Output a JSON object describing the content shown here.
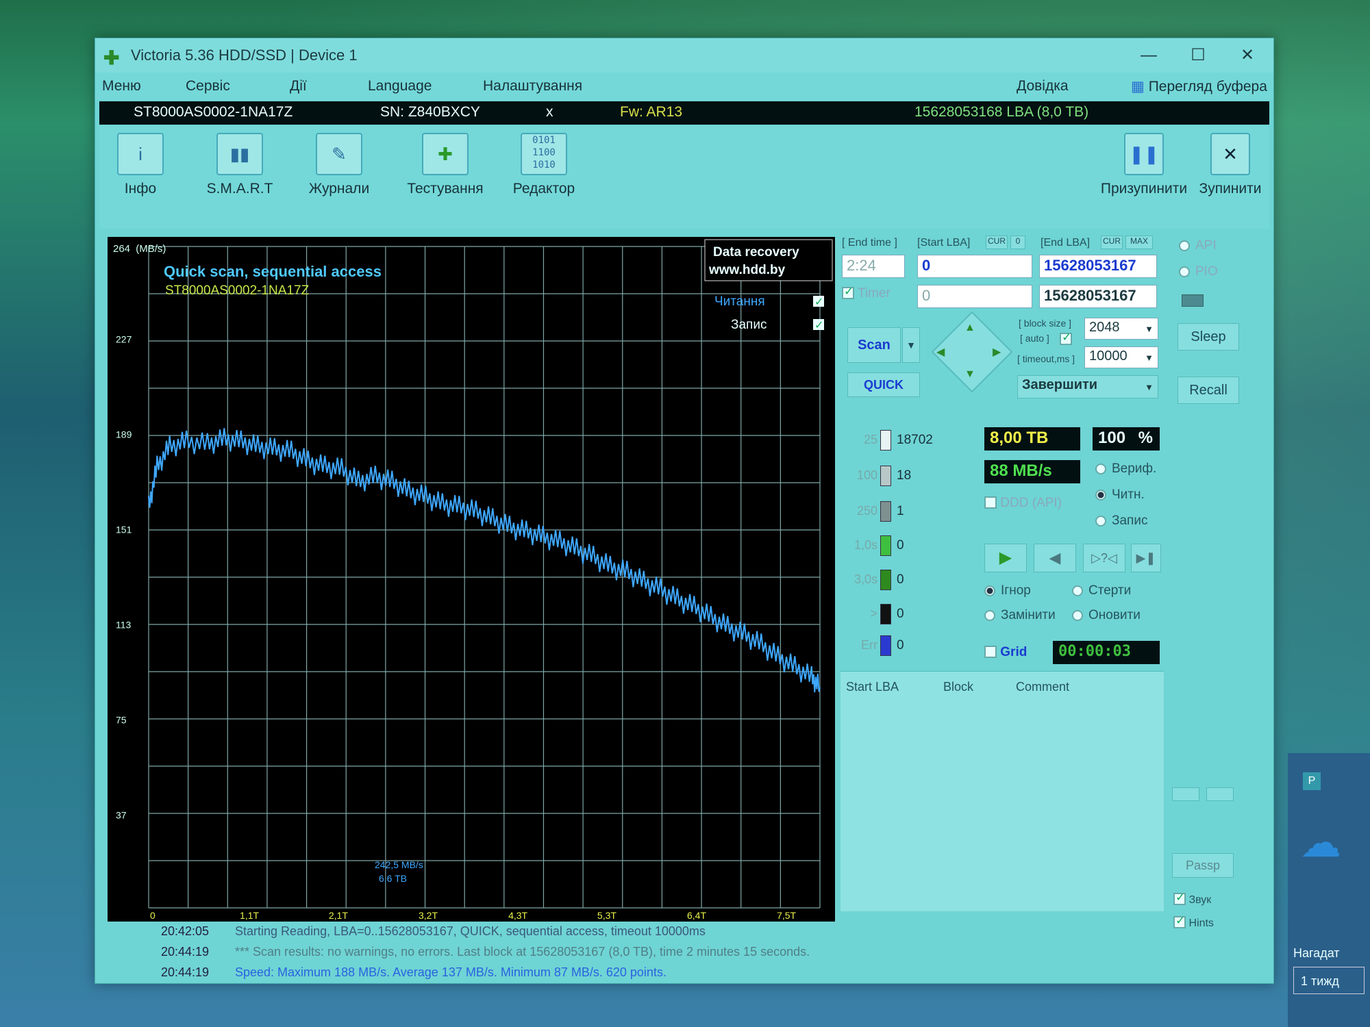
{
  "window": {
    "title": "Victoria 5.36 HDD/SSD | Device 1",
    "controls": {
      "minimize": "—",
      "maximize": "☐",
      "close": "✕"
    }
  },
  "menu": {
    "items": [
      "Меню",
      "Сервіс",
      "Дії",
      "Language",
      "Налаштування",
      "Довідка",
      "Перегляд буфера"
    ]
  },
  "device": {
    "model": "ST8000AS0002-1NA17Z",
    "serial": "SN: Z840BXCY",
    "x": "x",
    "firmware": "Fw: AR13",
    "capacity": "15628053168 LBA (8,0 TB)"
  },
  "toolbar": {
    "buttons": [
      "Інфо",
      "S.M.A.R.T",
      "Журнали",
      "Тестування",
      "Редактор"
    ],
    "pause": "Призупинити",
    "stop": "Зупинити"
  },
  "chart_data": {
    "type": "line",
    "title": "Quick scan, sequential access",
    "subtitle": "ST8000AS0002-1NA17Z",
    "y_unit": "(MB/s)",
    "ylim": [
      0,
      264
    ],
    "y_ticks": [
      "264",
      "227",
      "189",
      "151",
      "113",
      "75",
      "37"
    ],
    "x_ticks": [
      "0",
      "1,1T",
      "2,1T",
      "3,2T",
      "4,3T",
      "5,3T",
      "6,4T",
      "7,5T"
    ],
    "xlim": [
      0,
      8.0
    ],
    "grid": true,
    "series": [
      {
        "name": "Читання",
        "x": [
          0,
          0.1,
          0.25,
          0.45,
          0.7,
          0.9,
          1.1,
          1.3,
          1.5,
          1.7,
          1.9,
          2.1,
          2.3,
          2.5,
          2.7,
          2.9,
          3.1,
          3.3,
          3.5,
          3.7,
          3.9,
          4.1,
          4.3,
          4.5,
          4.7,
          4.9,
          5.1,
          5.3,
          5.5,
          5.7,
          5.9,
          6.1,
          6.3,
          6.5,
          6.7,
          6.9,
          7.1,
          7.3,
          7.5,
          7.7,
          7.9,
          8.0
        ],
        "y": [
          160,
          176,
          184,
          186,
          185,
          187,
          186,
          184,
          183,
          182,
          178,
          176,
          175,
          170,
          172,
          170,
          166,
          164,
          161,
          160,
          158,
          155,
          152,
          150,
          148,
          146,
          143,
          140,
          136,
          134,
          130,
          127,
          123,
          120,
          116,
          112,
          109,
          105,
          100,
          96,
          92,
          88
        ]
      }
    ],
    "legend": [
      "Читання",
      "Запис"
    ],
    "annotation": {
      "speed": "242,5 MB/s",
      "position": "6,6 TB"
    },
    "watermark": [
      "Data recovery",
      "www.hdd.by"
    ]
  },
  "controls": {
    "end_time_label": "[ End time ]",
    "end_time": "2:24",
    "timer_label": "Timer",
    "timer_value": "0",
    "start_lba_label": "[Start LBA]",
    "start_lba": "0",
    "cur": "CUR",
    "zero": "0",
    "end_lba_label": "[End LBA]",
    "max": "MAX",
    "end_lba": "15628053167",
    "end_lba2": "15628053167",
    "scan": "Scan",
    "quick": "QUICK",
    "block_size_label": "[ block size ]",
    "auto_label": "[ auto ]",
    "block_size": "2048",
    "timeout_label": "[ timeout,ms ]",
    "timeout": "10000",
    "finish": "Завершити"
  },
  "histogram": [
    {
      "label": "25",
      "value": "18702",
      "color": "#e8f4f4"
    },
    {
      "label": "100",
      "value": "18",
      "color": "#b8c8c8"
    },
    {
      "label": "250",
      "value": "1",
      "color": "#7f9090"
    },
    {
      "label": "1,0s",
      "value": "0",
      "color": "#3fbf3f"
    },
    {
      "label": "3,0s",
      "value": "0",
      "color": "#2e8a1e"
    },
    {
      "label": ">",
      "value": "0",
      "color": "#111111"
    },
    {
      "label": "Err",
      "value": "0",
      "color": "#2a3ad0"
    }
  ],
  "status": {
    "size": "8,00 TB",
    "percent": "100",
    "percent_sign": "%",
    "speed": "88 MB/s",
    "ddd": "DDD (API)",
    "modes": [
      "Вериф.",
      "Читн.",
      "Запис"
    ],
    "actions": [
      "Ігнор",
      "Стерти",
      "Замінити",
      "Оновити"
    ],
    "grid": "Grid",
    "elapsed": "00:00:03"
  },
  "table_headers": [
    "Start LBA",
    "Block",
    "Comment"
  ],
  "side": {
    "api": "API",
    "pio": "PIO",
    "sleep": "Sleep",
    "recall": "Recall",
    "passp": "Passp",
    "sound": "Звук",
    "hints": "Hints"
  },
  "log": [
    {
      "time": "20:42:05",
      "msg": "Starting Reading, LBA=0..15628053167, QUICK, sequential access, timeout 10000ms",
      "color": "#3a5a7a"
    },
    {
      "time": "20:44:19",
      "msg": "*** Scan results: no warnings, no errors. Last block at 15628053167 (8,0 TB), time 2 minutes 15 seconds.",
      "color": "#4f7f86"
    },
    {
      "time": "20:44:19",
      "msg": "Speed: Maximum 188 MB/s. Average 137 MB/s. Minimum 87 MB/s. 620 points.",
      "color": "#2a62e0"
    }
  ],
  "tray": {
    "reminder": "Нагадат",
    "week": "1 тижд"
  }
}
